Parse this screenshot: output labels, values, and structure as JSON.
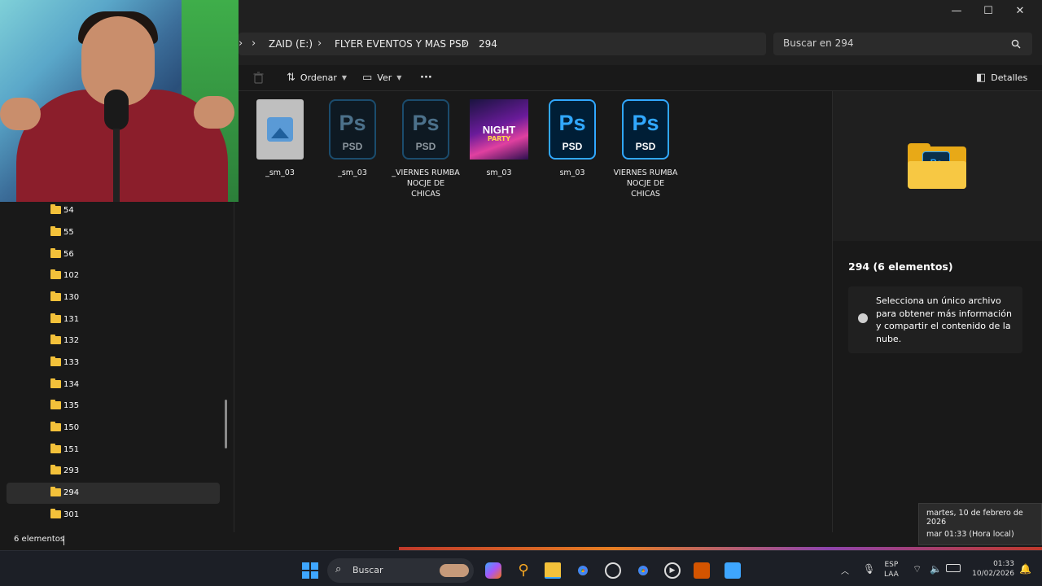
{
  "window": {
    "minimize": "—",
    "maximize": "☐",
    "close": "✕"
  },
  "breadcrumb": {
    "items": [
      "ZAID  (E:)",
      "FLYER EVENTOS Y MAS PSD",
      "294"
    ]
  },
  "search": {
    "placeholder": "Buscar en 294"
  },
  "commandbar": {
    "sort_label": "Ordenar",
    "view_label": "Ver",
    "more_label": "···",
    "details_label": "Detalles"
  },
  "navpane": {
    "items": [
      "54",
      "55",
      "56",
      "102",
      "130",
      "131",
      "132",
      "133",
      "134",
      "135",
      "150",
      "151",
      "293",
      "294",
      "301"
    ],
    "selected": "294"
  },
  "files": [
    {
      "name": "_sm_03",
      "type": "image"
    },
    {
      "name": "_sm_03",
      "type": "psd-dim"
    },
    {
      "name": "_VIERNES RUMBA NOCJE DE CHICAS",
      "type": "psd-dim"
    },
    {
      "name": "sm_03",
      "type": "thumbnail",
      "thumb_title": "NIGHT",
      "thumb_sub": "PARTY"
    },
    {
      "name": "sm_03",
      "type": "psd"
    },
    {
      "name": "VIERNES RUMBA NOCJE DE CHICAS",
      "type": "psd"
    }
  ],
  "psd_icon": {
    "ps": "Ps",
    "tag": "PSD"
  },
  "details": {
    "folder_badge": "Ps",
    "title": "294 (6 elementos)",
    "info": "Selecciona un único archivo para obtener más información y compartir el contenido de la nube."
  },
  "status": {
    "count": "6 elementos"
  },
  "tooltip": {
    "date_long": "martes, 10 de febrero de 2026",
    "time_local": "mar 01:33 (Hora local)"
  },
  "taskbar": {
    "search_label": "Buscar",
    "lang_top": "ESP",
    "lang_bottom": "LAA",
    "time": "01:33",
    "date": "10/02/2026"
  },
  "colors": {
    "accent": "#31a8ff",
    "folder": "#f3c13a",
    "background": "#191919"
  }
}
